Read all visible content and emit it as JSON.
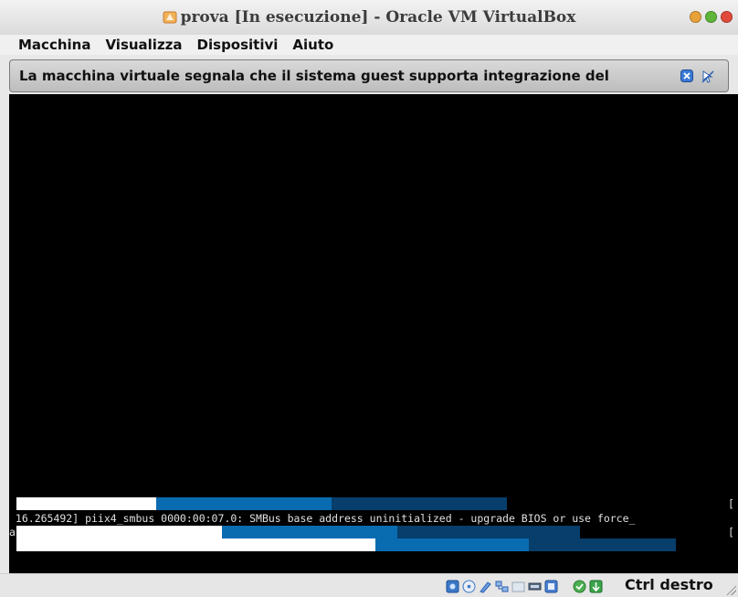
{
  "window": {
    "title": "prova [In esecuzione] - Oracle VM VirtualBox",
    "title_icon": "virtualbox-vm-icon",
    "controls": [
      {
        "name": "minimize-button",
        "color": "#e8a23a"
      },
      {
        "name": "maximize-button",
        "color": "#5fb53a"
      },
      {
        "name": "close-button",
        "color": "#e04a3a"
      }
    ]
  },
  "menubar": {
    "items": [
      "Macchina",
      "Visualizza",
      "Dispositivi",
      "Aiuto"
    ]
  },
  "notification": {
    "text": "La macchina virtuale segnala che il sistema guest supporta integrazione del",
    "icons": [
      "close-icon",
      "mouse-integration-icon"
    ]
  },
  "console": {
    "line1_right": "[",
    "line2": " 16.265492] piix4_smbus 0000:00:07.0: SMBus base address uninitialized - upgrade BIOS or use force_",
    "line3_left": "a",
    "line3_right": "[",
    "colors": {
      "white": "#ffffff",
      "blue": "#0a6cb0",
      "dark_blue": "#073e6b",
      "text": "#e0e0e0"
    }
  },
  "statusbar": {
    "icons": [
      "hard-disk-icon",
      "optical-drive-icon",
      "audio-icon",
      "network-icon",
      "shared-folders-icon",
      "display-icon",
      "usb-icon",
      "guest-additions-icon",
      "mouse-capture-icon"
    ],
    "host_key": "Ctrl destro"
  }
}
